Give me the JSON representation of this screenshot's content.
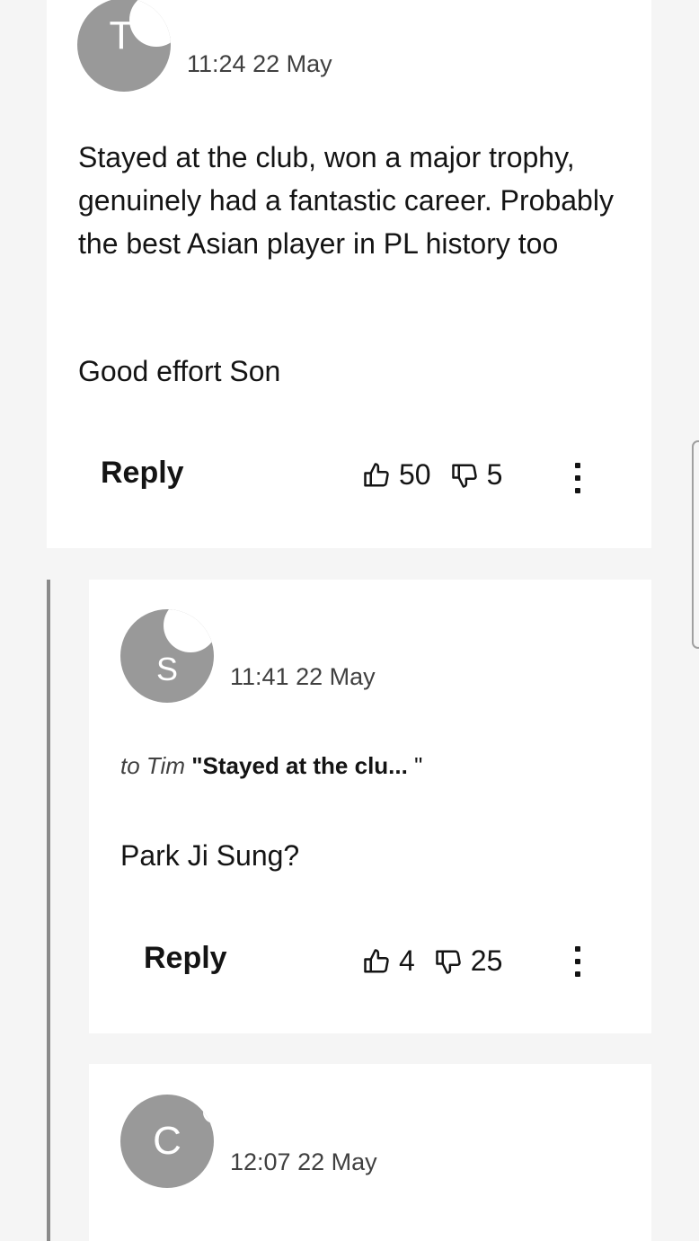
{
  "comments": [
    {
      "avatar_initial": "T",
      "timestamp": "11:24 22 May",
      "paragraphs": [
        "Stayed at the club, won a major trophy, genuinely had a fantastic career. Probably the best Asian player in PL history too",
        "Good effort Son"
      ],
      "reply_label": "Reply",
      "upvotes": "50",
      "downvotes": "5"
    },
    {
      "avatar_initial": "S",
      "timestamp": "11:41 22 May",
      "reply_to": {
        "prefix": "to Tim",
        "quote": "\"Stayed at the clu... ",
        "close": "\""
      },
      "paragraphs": [
        "Park Ji Sung?"
      ],
      "reply_label": "Reply",
      "upvotes": "4",
      "downvotes": "25"
    },
    {
      "avatar_initial": "C",
      "timestamp": "12:07 22 May"
    }
  ],
  "icons": {
    "upvote": "thumbs-up-icon",
    "downvote": "thumbs-down-icon",
    "more": "more-options-icon"
  },
  "colors": {
    "background": "#f5f5f5",
    "card": "#ffffff",
    "avatar": "#999999",
    "thread_line": "#8a8a8a"
  }
}
